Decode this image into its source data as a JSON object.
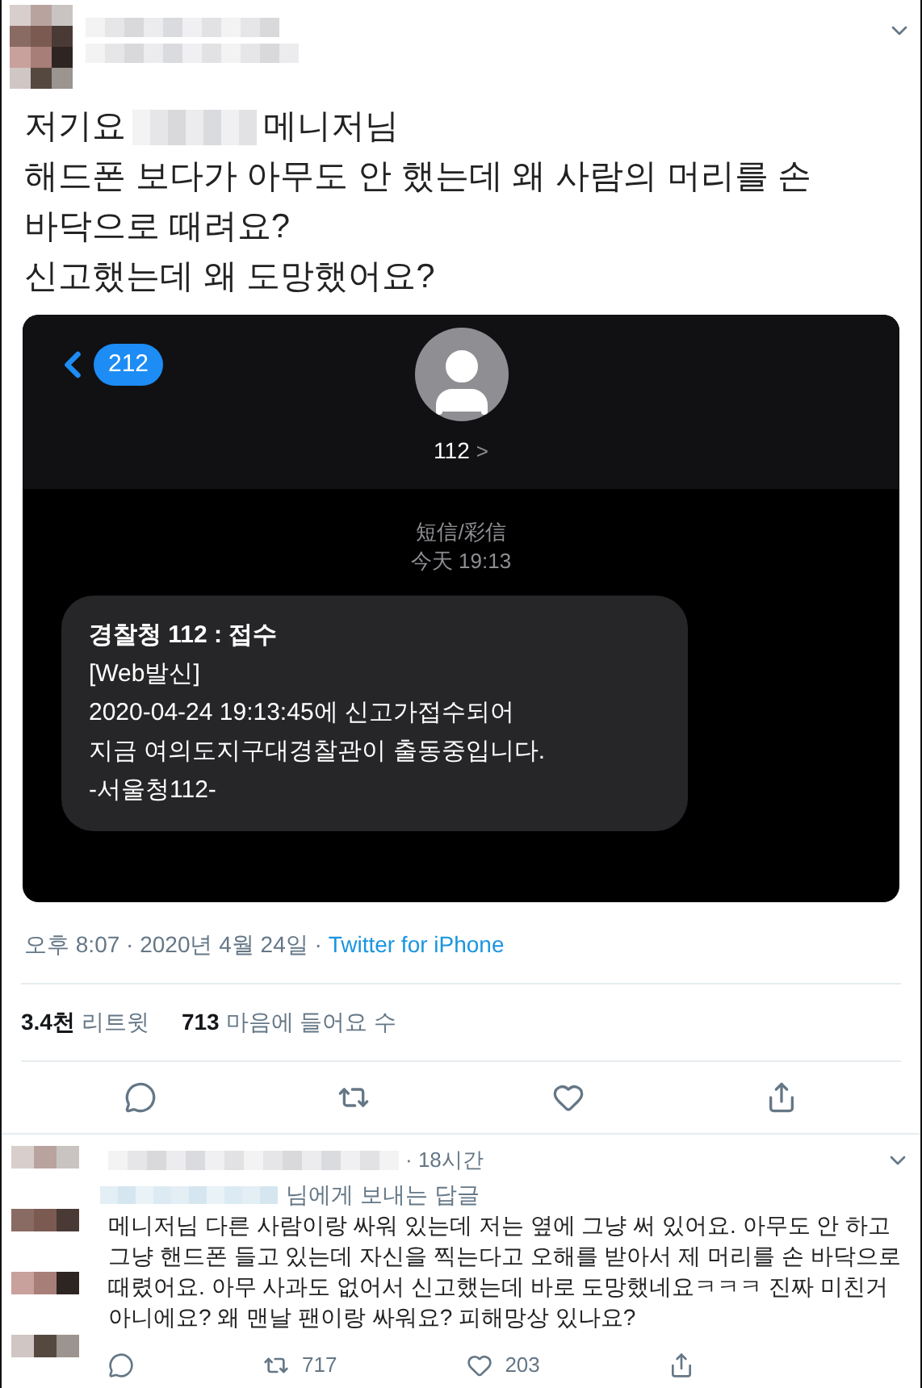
{
  "tweet": {
    "text_first_line": [
      "저기요",
      "메니저님"
    ],
    "text_lines": [
      "해드폰 보다가 아무도 안 했는데 왜 사람의 머리를 손",
      "바닥으로 때려요?",
      "신고했는데 왜 도망했어요?"
    ],
    "screenshot": {
      "back_count": "212",
      "contact": "112",
      "chevron": ">",
      "service": "短信/彩信",
      "time": "今天 19:13",
      "message": {
        "title": "경찰청 112 : 접수",
        "lines": [
          "[Web발신]",
          "2020-04-24 19:13:45에 신고가접수되어",
          "지금 여의도지구대경찰관이 출동중입니다.",
          "-서울청112-"
        ]
      }
    },
    "meta": {
      "time": "오후 8:07 · 2020년 4월 24일 · ",
      "source": "Twitter for iPhone"
    },
    "stats": [
      {
        "count": "3.4천",
        "label": "리트윗"
      },
      {
        "count": "713",
        "label": "마음에 들어요 수"
      }
    ]
  },
  "reply": {
    "age": "· 18시간",
    "replying_to": "님에게 보내는 답글",
    "text": "메니저님 다른 사람이랑 싸워 있는데 저는 옆에 그냥 써 있어요. 아무도 안 하고 그냥 핸드폰 들고 있는데 자신을 찍는다고 오해를 받아서 제 머리를 손 바닥으로 때렸어요. 아무 사과도 없어서 신고했는데 바로 도망했네요ㅋㅋㅋ 진짜 미친거 아니에요? 왜 맨날 팬이랑 싸워요? 피해망상 있나요?",
    "retweets": "717",
    "likes": "203"
  }
}
